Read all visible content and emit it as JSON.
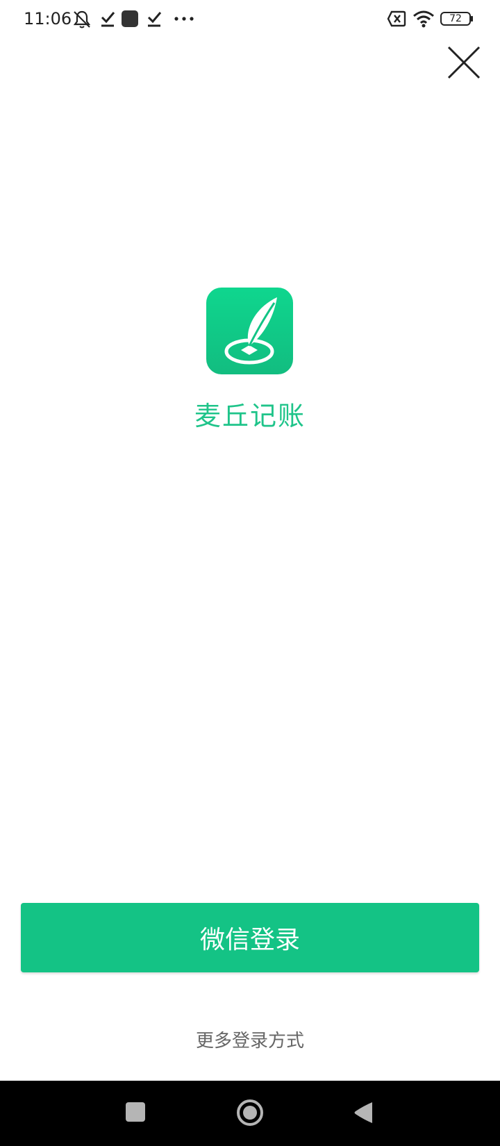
{
  "status_bar": {
    "time": "11:06",
    "battery": "72",
    "icons": [
      "mute-icon",
      "download-done-icon",
      "app-square-icon",
      "download-done-icon",
      "more-dots-icon",
      "sim-x-icon",
      "wifi-icon",
      "battery-icon"
    ]
  },
  "app": {
    "name": "麦丘记账",
    "brand_color": "#1fc48a",
    "icon": "feather-pen-icon"
  },
  "login": {
    "wechat_button": "微信登录",
    "button_color": "#14c385",
    "more_options": "更多登录方式"
  },
  "nav_bar": {
    "buttons": [
      "recents-square-icon",
      "home-circle-icon",
      "back-triangle-icon"
    ]
  }
}
